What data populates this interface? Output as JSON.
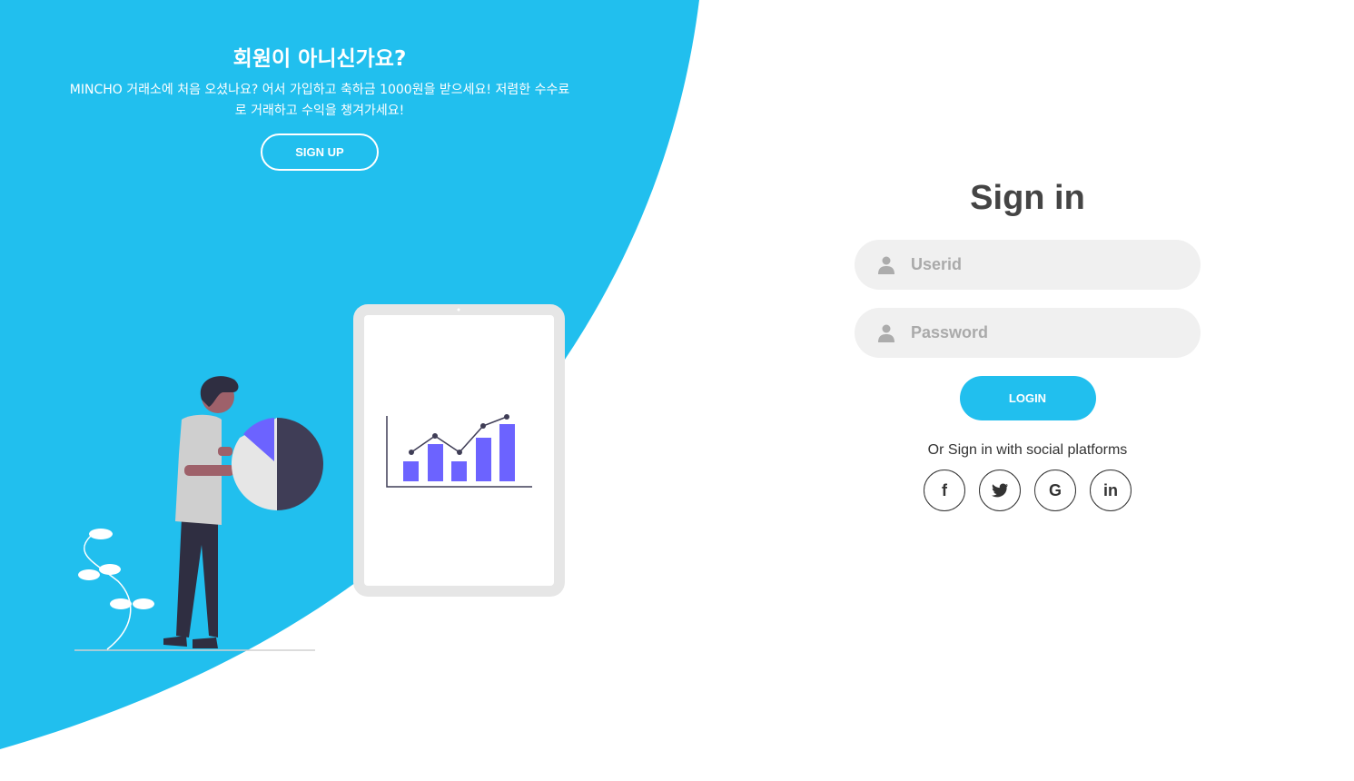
{
  "colors": {
    "accent": "#21bfee",
    "illustration_purple": "#6c63ff",
    "text_dark": "#444444"
  },
  "left_panel": {
    "title": "회원이 아니신가요?",
    "description": "MINCHO 거래소에 처음 오셨나요? 어서 가입하고 축하금 1000원을 받으세요! 저렴한 수수료로 거래하고 수익을 챙겨가세요!",
    "signup_label": "SIGN UP"
  },
  "signin": {
    "title": "Sign in",
    "userid_placeholder": "Userid",
    "password_placeholder": "Password",
    "login_label": "LOGIN",
    "social_text": "Or Sign in with social platforms",
    "social": [
      {
        "icon": "facebook-icon",
        "glyph": "f"
      },
      {
        "icon": "twitter-icon",
        "glyph": "🐦"
      },
      {
        "icon": "google-icon",
        "glyph": "G"
      },
      {
        "icon": "linkedin-icon",
        "glyph": "in"
      }
    ]
  }
}
